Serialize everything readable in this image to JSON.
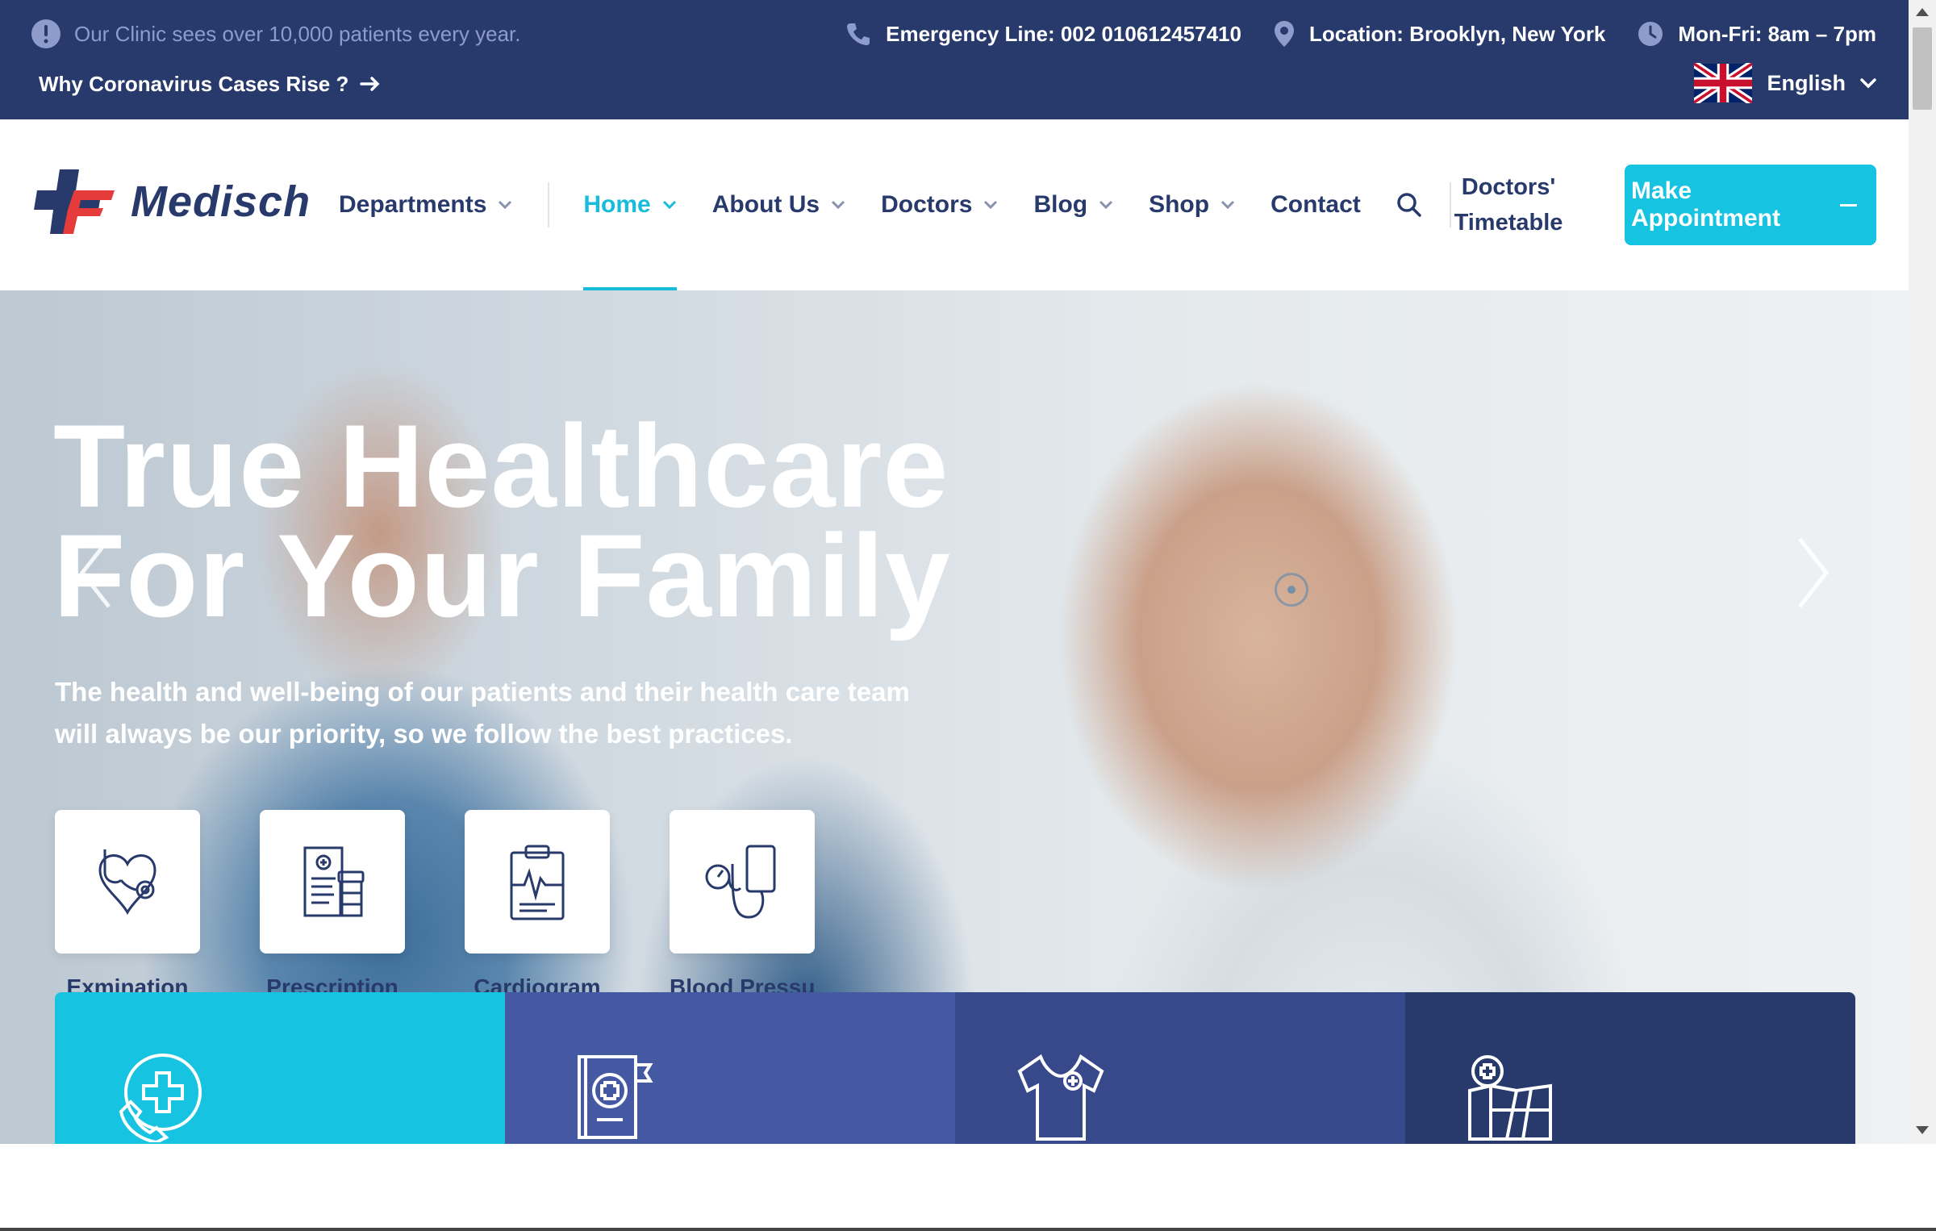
{
  "topbar": {
    "notice": "Our Clinic sees over 10,000 patients every year.",
    "news_link": "Why Coronavirus Cases Rise ?",
    "emergency": "Emergency Line: 002 010612457410",
    "location": "Location: Brooklyn, New York",
    "hours": "Mon-Fri: 8am – 7pm",
    "language": "English"
  },
  "header": {
    "logo_text": "Medisch",
    "nav": [
      {
        "label": "Departments",
        "has_dropdown": true
      },
      {
        "label": "Home",
        "has_dropdown": true,
        "active": true
      },
      {
        "label": "About Us",
        "has_dropdown": true
      },
      {
        "label": "Doctors",
        "has_dropdown": true
      },
      {
        "label": "Blog",
        "has_dropdown": true
      },
      {
        "label": "Shop",
        "has_dropdown": true
      },
      {
        "label": "Contact",
        "has_dropdown": false
      }
    ],
    "timetable_line1": "Doctors'",
    "timetable_line2": "Timetable",
    "appointment_button": "Make Appointment"
  },
  "hero": {
    "title_line1": "True Healthcare",
    "title_line2": "For Your Family",
    "subtitle_line1": "The health and well-being of our patients and their health care team",
    "subtitle_line2": "will always be our priority, so we follow the best practices.",
    "features": [
      {
        "label": "Exmination",
        "icon": "stethoscope-heart-icon"
      },
      {
        "label": "Prescription",
        "icon": "prescription-pills-icon"
      },
      {
        "label": "Cardiogram",
        "icon": "cardiogram-clipboard-icon"
      },
      {
        "label": "Blood Pressure",
        "icon": "blood-pressure-icon"
      }
    ],
    "cards": [
      {
        "icon": "phone-medical-icon",
        "color": "#16c3e0"
      },
      {
        "icon": "medical-book-icon",
        "color": "#4459a2"
      },
      {
        "icon": "medical-uniform-icon",
        "color": "#37498a"
      },
      {
        "icon": "medical-map-icon",
        "color": "#273a6b"
      }
    ]
  },
  "colors": {
    "navy": "#273a6b",
    "accent": "#16c3e0",
    "muted": "#8e9ccb"
  }
}
